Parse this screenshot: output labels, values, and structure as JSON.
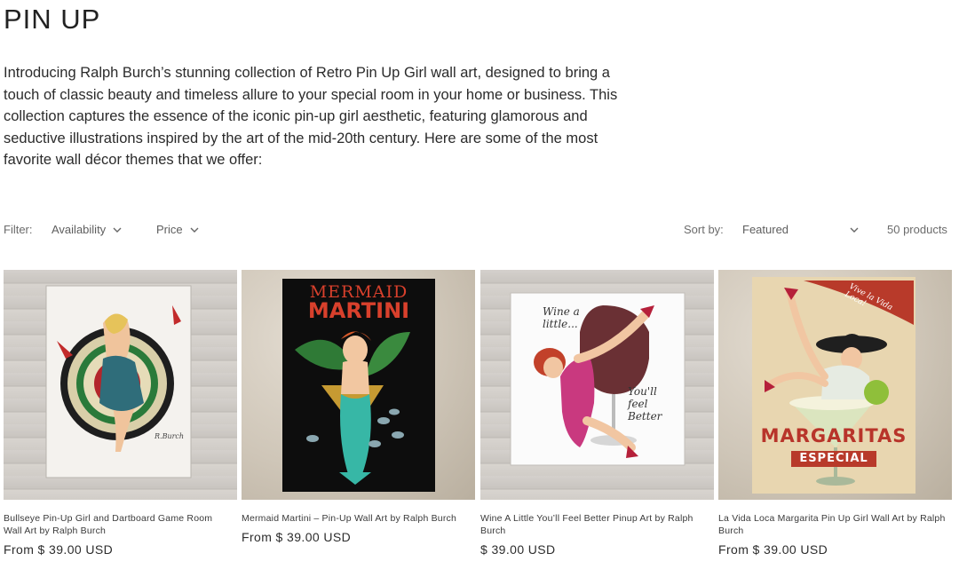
{
  "page": {
    "title": "PIN UP",
    "intro": "Introducing Ralph Burch’s stunning collection of Retro Pin Up Girl wall art, designed to bring a touch of classic beauty and timeless allure to your special room in your home or business. This collection captures the essence of the iconic pin-up girl aesthetic, featuring glamorous and seductive illustrations inspired by the art of the mid-20th century. Here are some of the most favorite wall décor themes that we offer:"
  },
  "filters": {
    "label": "Filter:",
    "availability": "Availability",
    "price": "Price",
    "sort_label": "Sort by:",
    "sort_value": "Featured",
    "count": "50 products"
  },
  "products": [
    {
      "name": "Bullseye Pin-Up Girl and Dartboard Game Room Wall Art by Ralph Burch",
      "price": "From $ 39.00 USD"
    },
    {
      "name": "Mermaid Martini – Pin-Up Wall Art by Ralph Burch",
      "price": "From $ 39.00 USD",
      "art_title_top": "MERMAID",
      "art_title_bottom": "MARTINI"
    },
    {
      "name": "Wine A Little You’ll Feel Better Pinup Art by Ralph Burch",
      "price": "$ 39.00 USD",
      "art_text_top": "Wine a little...",
      "art_text_bottom": "You'll feel Better"
    },
    {
      "name": "La Vida Loca Margarita Pin Up Girl Wall Art by Ralph Burch",
      "price": "From $ 39.00 USD",
      "art_banner": "Vive la Vida Loca!",
      "art_title": "MARGARITAS",
      "art_ribbon": "ESPECIAL"
    }
  ]
}
